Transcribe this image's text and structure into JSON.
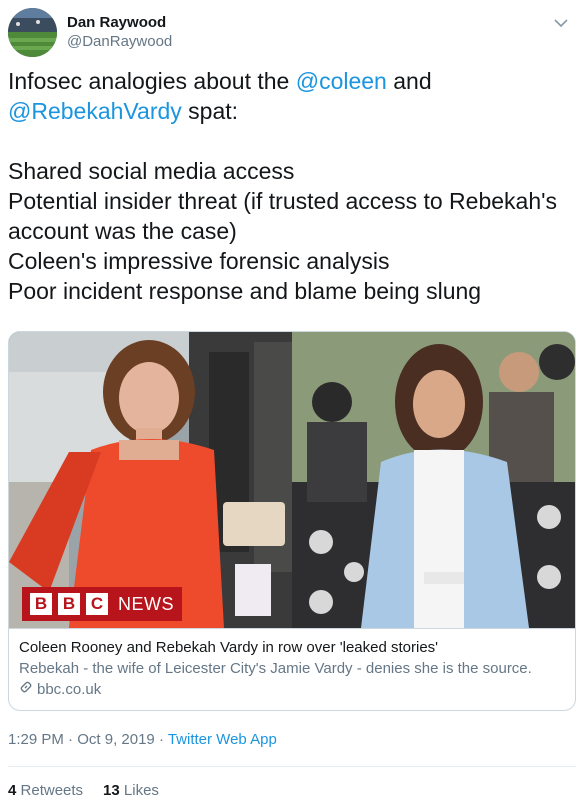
{
  "author": {
    "name": "Dan Raywood",
    "handle": "@DanRaywood"
  },
  "tweet": {
    "line1_pre": "Infosec analogies about the ",
    "mention1": "@coleen",
    "line1_post": " and",
    "mention2": "@RebekahVardy",
    "line2_post": " spat:",
    "lines": [
      "Shared social media access",
      "Potential insider threat (if trusted access to Rebekah's",
      "account was the case)",
      "Coleen's impressive forensic analysis",
      "Poor incident response and blame being slung"
    ]
  },
  "card": {
    "logo_letters": [
      "B",
      "B",
      "C"
    ],
    "logo_word": "NEWS",
    "title": "Coleen Rooney and Rebekah Vardy in row over 'leaked stories'",
    "description": "Rebekah - the wife of Leicester City's Jamie Vardy - denies she is the source.",
    "domain": "bbc.co.uk"
  },
  "meta": {
    "time": "1:29 PM",
    "separator": " · ",
    "date": "Oct 9, 2019",
    "source": "Twitter Web App"
  },
  "stats": {
    "retweets_count": "4",
    "retweets_label": "Retweets",
    "likes_count": "13",
    "likes_label": "Likes"
  },
  "colors": {
    "link": "#1b95e0",
    "secondary_text": "#657786",
    "bbc_red": "#b8141c",
    "dress_orange": "#ee4a2c"
  },
  "icons": {
    "caret": "chevron-down-icon",
    "link": "link-icon"
  }
}
